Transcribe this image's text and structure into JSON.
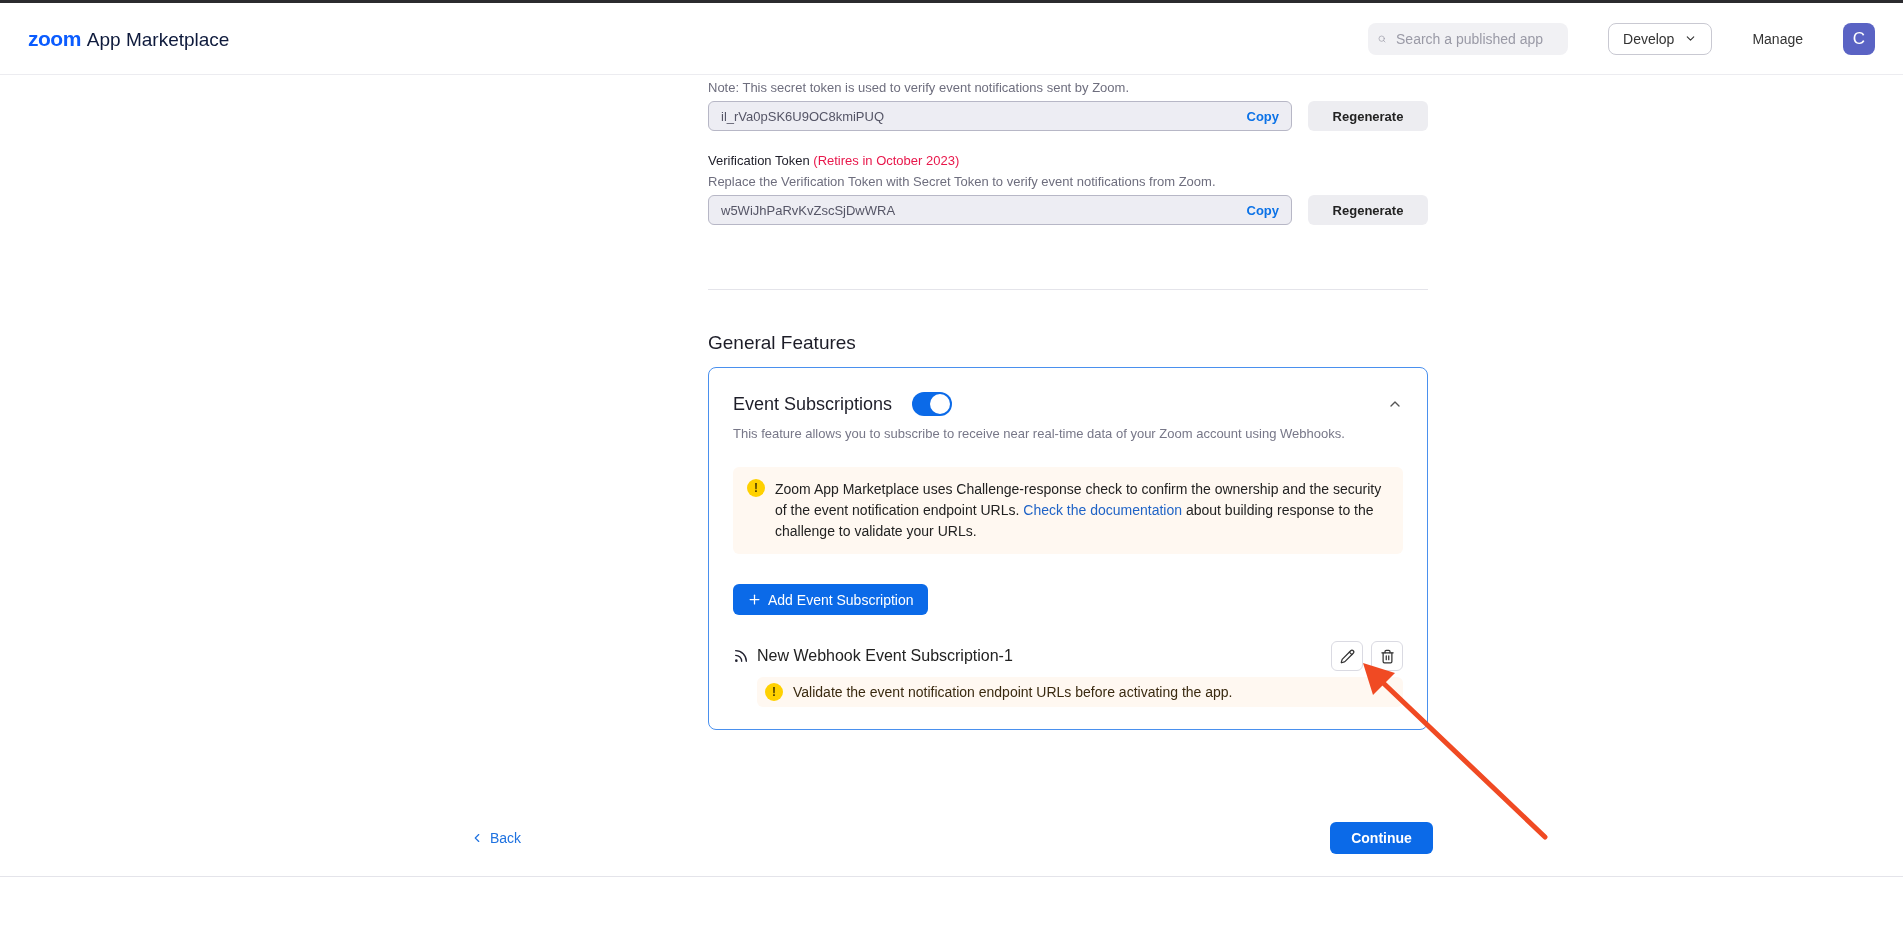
{
  "header": {
    "logo_mark": "zoom",
    "logo_text": "App Marketplace",
    "search": {
      "placeholder": "Search a published app"
    },
    "develop": "Develop",
    "manage": "Manage",
    "avatar": "C"
  },
  "secret_token": {
    "note": "Note: This secret token is used to verify event notifications sent by Zoom.",
    "value": "il_rVa0pSK6U9OC8kmiPUQ",
    "copy": "Copy",
    "regenerate": "Regenerate"
  },
  "verification_token": {
    "label": "Verification Token",
    "retire_note": "(Retires in October 2023)",
    "description": "Replace the Verification Token with Secret Token to verify event notifications from Zoom.",
    "value": "w5WiJhPaRvKvZscSjDwWRA",
    "copy": "Copy",
    "regenerate": "Regenerate"
  },
  "general_features": {
    "title": "General Features",
    "event_subscriptions": {
      "title": "Event Subscriptions",
      "on": true,
      "expanded": true,
      "description": "This feature allows you to subscribe to receive near real-time data of your Zoom account using Webhooks.",
      "alert": {
        "icon": "!",
        "text_before": "Zoom App Marketplace uses Challenge-response check to confirm the ownership and the security of the event notification endpoint URLs.",
        "link": "Check the documentation",
        "text_after": "about building response to the challenge to validate your URLs."
      },
      "add_button": "Add Event Subscription",
      "subscriptions": [
        {
          "name": "New Webhook Event Subscription-1",
          "icon": "!",
          "warning": "Validate the event notification endpoint URLs before activating the app."
        }
      ]
    }
  },
  "footer": {
    "back": "Back",
    "continue": "Continue"
  }
}
